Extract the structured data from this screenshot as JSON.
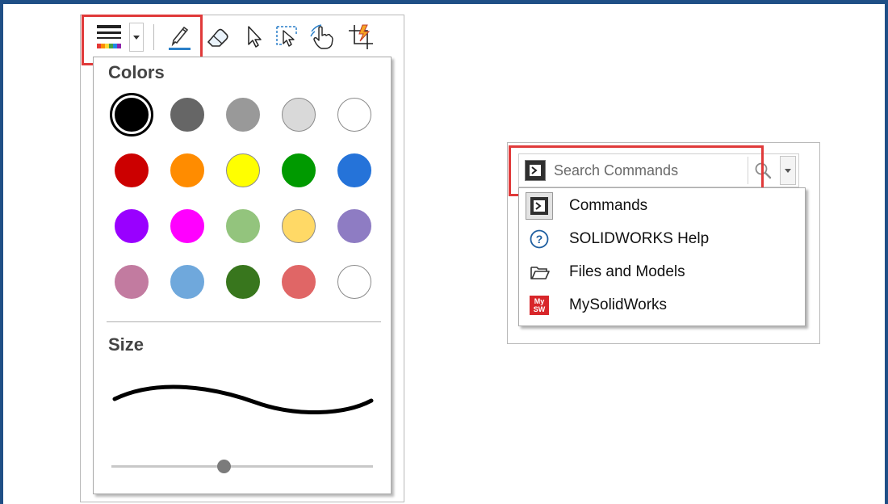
{
  "ink_panel": {
    "colors_title": "Colors",
    "size_title": "Size",
    "selected_color": "#000000",
    "size_slider_value": 0.43,
    "colors": [
      [
        "#000000",
        "#666666",
        "#999999",
        "#d9d9d9",
        "#ffffff"
      ],
      [
        "#cc0000",
        "#ff8c00",
        "#ffff00",
        "#009a00",
        "#2573d9"
      ],
      [
        "#9900ff",
        "#ff00ff",
        "#93c47d",
        "#ffd966",
        "#8e7cc3"
      ],
      [
        "#c27ba0",
        "#6fa8dc",
        "#38761d",
        "#e06666",
        "#ffffff"
      ]
    ]
  },
  "toolbar": {
    "tools": [
      "line-style",
      "pen",
      "eraser",
      "select",
      "lasso-select",
      "touch",
      "crop"
    ],
    "accent_color": "#e03a3a"
  },
  "search_panel": {
    "placeholder": "Search Commands",
    "items": [
      {
        "label": "Commands",
        "icon": "command-prompt-icon"
      },
      {
        "label": "SOLIDWORKS Help",
        "icon": "help-icon"
      },
      {
        "label": "Files and Models",
        "icon": "folder-icon"
      },
      {
        "label": "MySolidWorks",
        "icon": "mysolidworks-icon",
        "icon_text_top": "My",
        "icon_text_bottom": "SW"
      }
    ]
  }
}
